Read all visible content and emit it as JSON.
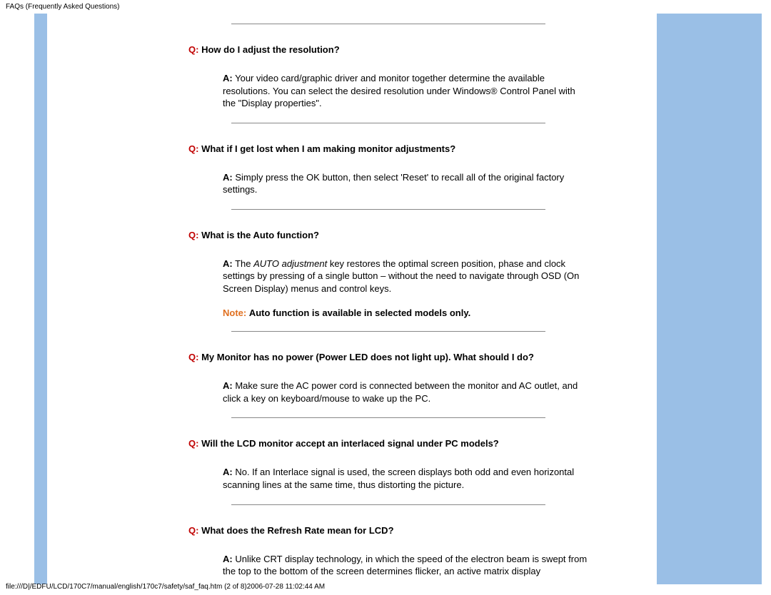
{
  "header": "FAQs (Frequently Asked Questions)",
  "footer": "file:///D|/EDFU/LCD/170C7/manual/english/170c7/safety/saf_faq.htm (2 of 8)2006-07-28 11:02:44 AM",
  "q_prefix": "Q:",
  "a_prefix": "A:",
  "note_prefix": "Note:",
  "faq": [
    {
      "q": "How do I adjust the resolution?",
      "a": "Your video card/graphic driver and monitor together determine the available resolutions. You can select the desired resolution under Windows® Control Panel with the \"Display properties\"."
    },
    {
      "q": "What if I get lost when I am making monitor adjustments?",
      "a": "Simply press the OK button, then select 'Reset' to recall all of the original factory settings."
    },
    {
      "q": "What is the Auto function?",
      "a_pre": "The ",
      "a_italic": "AUTO adjustment",
      "a_post": " key restores the optimal screen position, phase and clock settings by pressing of a single button – without the need to navigate through OSD (On Screen Display) menus and control keys.",
      "note": "Auto function is available in selected models only."
    },
    {
      "q": "My Monitor has no power (Power LED does not light up). What should I do?",
      "a": "Make sure the AC power cord is connected between the monitor and AC outlet, and click a key on keyboard/mouse to wake up the PC."
    },
    {
      "q": "Will the LCD monitor accept an interlaced signal under PC models?",
      "a": "No. If an Interlace signal is used, the screen displays both odd and even horizontal scanning lines at the same time, thus distorting the picture."
    },
    {
      "q": "What does the Refresh Rate mean for LCD?",
      "a": "Unlike CRT display technology, in which the speed of the electron beam is swept from the top to the bottom of the screen determines flicker, an active matrix display"
    }
  ]
}
